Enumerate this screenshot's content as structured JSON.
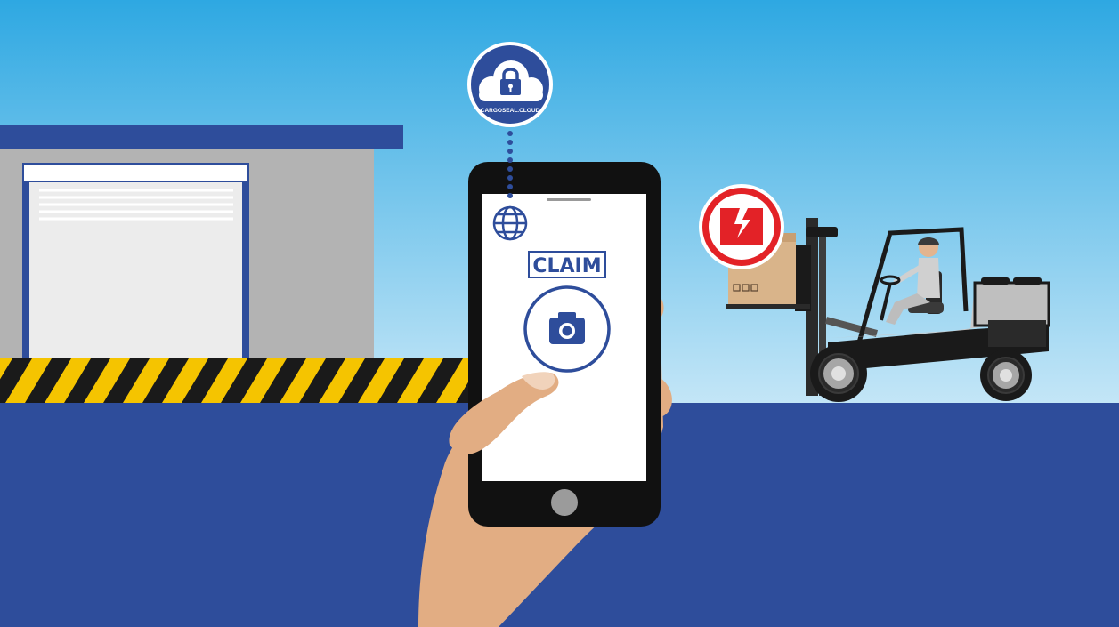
{
  "brand": {
    "name": "CARGOSEAL.CLOUD"
  },
  "phone": {
    "claim_label": "CLAIM"
  },
  "colors": {
    "sky_top": "#2ea8e2",
    "sky_bottom": "#bfe3f6",
    "ground": "#2e4d9b",
    "navy": "#2e4d9b",
    "warehouse_wall": "#b3b3b3",
    "stripe_yellow": "#f5c400",
    "stripe_black": "#1a1a1a",
    "alert_red": "#e32227",
    "skin": "#e2ad83"
  },
  "icons": {
    "cloud_lock": "cloud-lock-icon",
    "globe": "globe-icon",
    "camera": "camera-icon",
    "damaged_package": "damaged-package-icon"
  }
}
